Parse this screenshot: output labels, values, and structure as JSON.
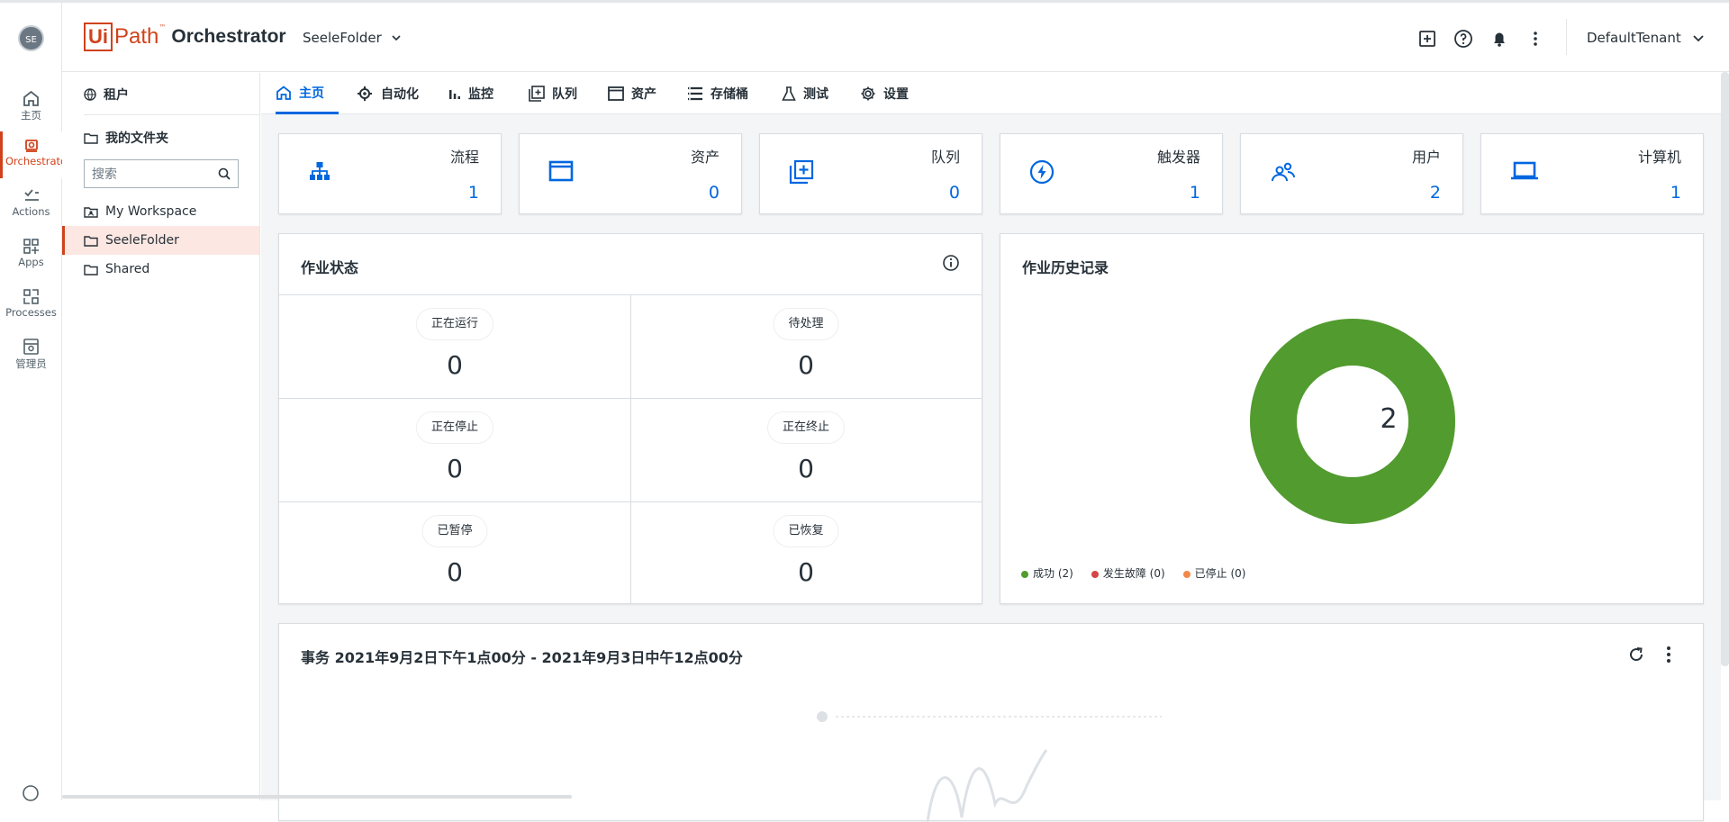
{
  "user": {
    "initials": "SE"
  },
  "rail": {
    "items": [
      {
        "label": "主页",
        "icon": "home-icon"
      },
      {
        "label": "Orchestrator",
        "icon": "orchestrator-icon"
      },
      {
        "label": "Actions",
        "icon": "actions-icon"
      },
      {
        "label": "Apps",
        "icon": "apps-icon"
      },
      {
        "label": "Processes",
        "icon": "processes-icon"
      },
      {
        "label": "管理员",
        "icon": "admin-icon"
      }
    ],
    "accent": "#d0421b"
  },
  "header": {
    "logo_ui": "Ui",
    "logo_path": "Path",
    "logo_tm": "™",
    "logo_product": "Orchestrator",
    "folder": "SeeleFolder",
    "tenant": "DefaultTenant"
  },
  "tree": {
    "tenant_label": "租户",
    "my_folders_label": "我的文件夹",
    "search_placeholder": "搜索",
    "folders": [
      "My Workspace",
      "SeeleFolder",
      "Shared"
    ],
    "selected": "SeeleFolder"
  },
  "tabs": [
    "主页",
    "自动化",
    "监控",
    "队列",
    "资产",
    "存储桶",
    "测试",
    "设置"
  ],
  "stats": [
    {
      "title": "流程",
      "value": "1",
      "icon": "process-icon"
    },
    {
      "title": "资产",
      "value": "0",
      "icon": "asset-icon"
    },
    {
      "title": "队列",
      "value": "0",
      "icon": "queue-icon"
    },
    {
      "title": "触发器",
      "value": "1",
      "icon": "trigger-icon"
    },
    {
      "title": "用户",
      "value": "2",
      "icon": "users-icon"
    },
    {
      "title": "计算机",
      "value": "1",
      "icon": "computer-icon"
    }
  ],
  "job_status": {
    "title": "作业状态",
    "cells": [
      {
        "label": "正在运行",
        "value": "0"
      },
      {
        "label": "待处理",
        "value": "0"
      },
      {
        "label": "正在停止",
        "value": "0"
      },
      {
        "label": "正在终止",
        "value": "0"
      },
      {
        "label": "已暂停",
        "value": "0"
      },
      {
        "label": "已恢复",
        "value": "0"
      }
    ]
  },
  "job_history": {
    "title": "作业历史记录",
    "total": "2",
    "legend": [
      {
        "label": "成功 (2)",
        "color": "#529b2f"
      },
      {
        "label": "发生故障 (0)",
        "color": "#d64545"
      },
      {
        "label": "已停止 (0)",
        "color": "#f2884b"
      }
    ]
  },
  "chart_data": {
    "type": "pie",
    "categories": [
      "成功",
      "发生故障",
      "已停止"
    ],
    "values": [
      2,
      0,
      0
    ],
    "title": "作业历史记录",
    "center_label": "2"
  },
  "transactions": {
    "title": "事务 2021年9月2日下午1点00分 - 2021年9月3日中午12点00分"
  }
}
